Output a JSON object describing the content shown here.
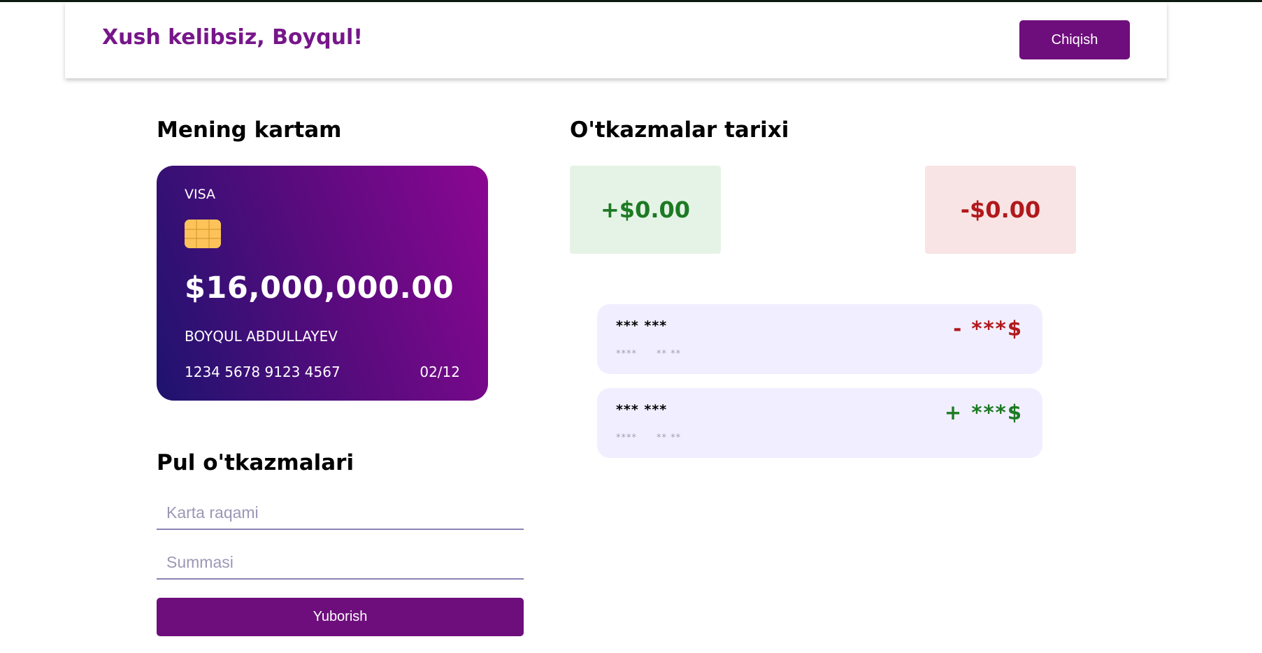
{
  "header": {
    "greeting": "Xush kelibsiz, Boyqul!",
    "logout_label": "Chiqish"
  },
  "card_section": {
    "title": "Mening kartam"
  },
  "card": {
    "brand": "VISA",
    "chip_icon": "sim-chip-icon",
    "balance": "$16,000,000.00",
    "holder": "BOYQUL ABDULLAYEV",
    "number": "1234 5678 9123 4567",
    "expiry": "02/12"
  },
  "transfer_section": {
    "title": "Pul o'tkazmalari",
    "card_number_placeholder": "Karta raqami",
    "card_number_value": "",
    "amount_placeholder": "Summasi",
    "amount_value": "",
    "send_label": "Yuborish"
  },
  "history": {
    "title": "O'tkazmalar tarixi",
    "income_total": "+$0.00",
    "expense_total": "-$0.00",
    "items": [
      {
        "name": "*** ***",
        "meta_a": "****",
        "meta_b": "** **",
        "amount": "- ***$",
        "direction": "out"
      },
      {
        "name": "*** ***",
        "meta_a": "****",
        "meta_b": "** **",
        "amount": "+ ***$",
        "direction": "in"
      }
    ]
  },
  "colors": {
    "brand": "#6e0e7c",
    "heading_accent": "#77168a",
    "income": "#1d7a24",
    "expense": "#b1181c"
  }
}
